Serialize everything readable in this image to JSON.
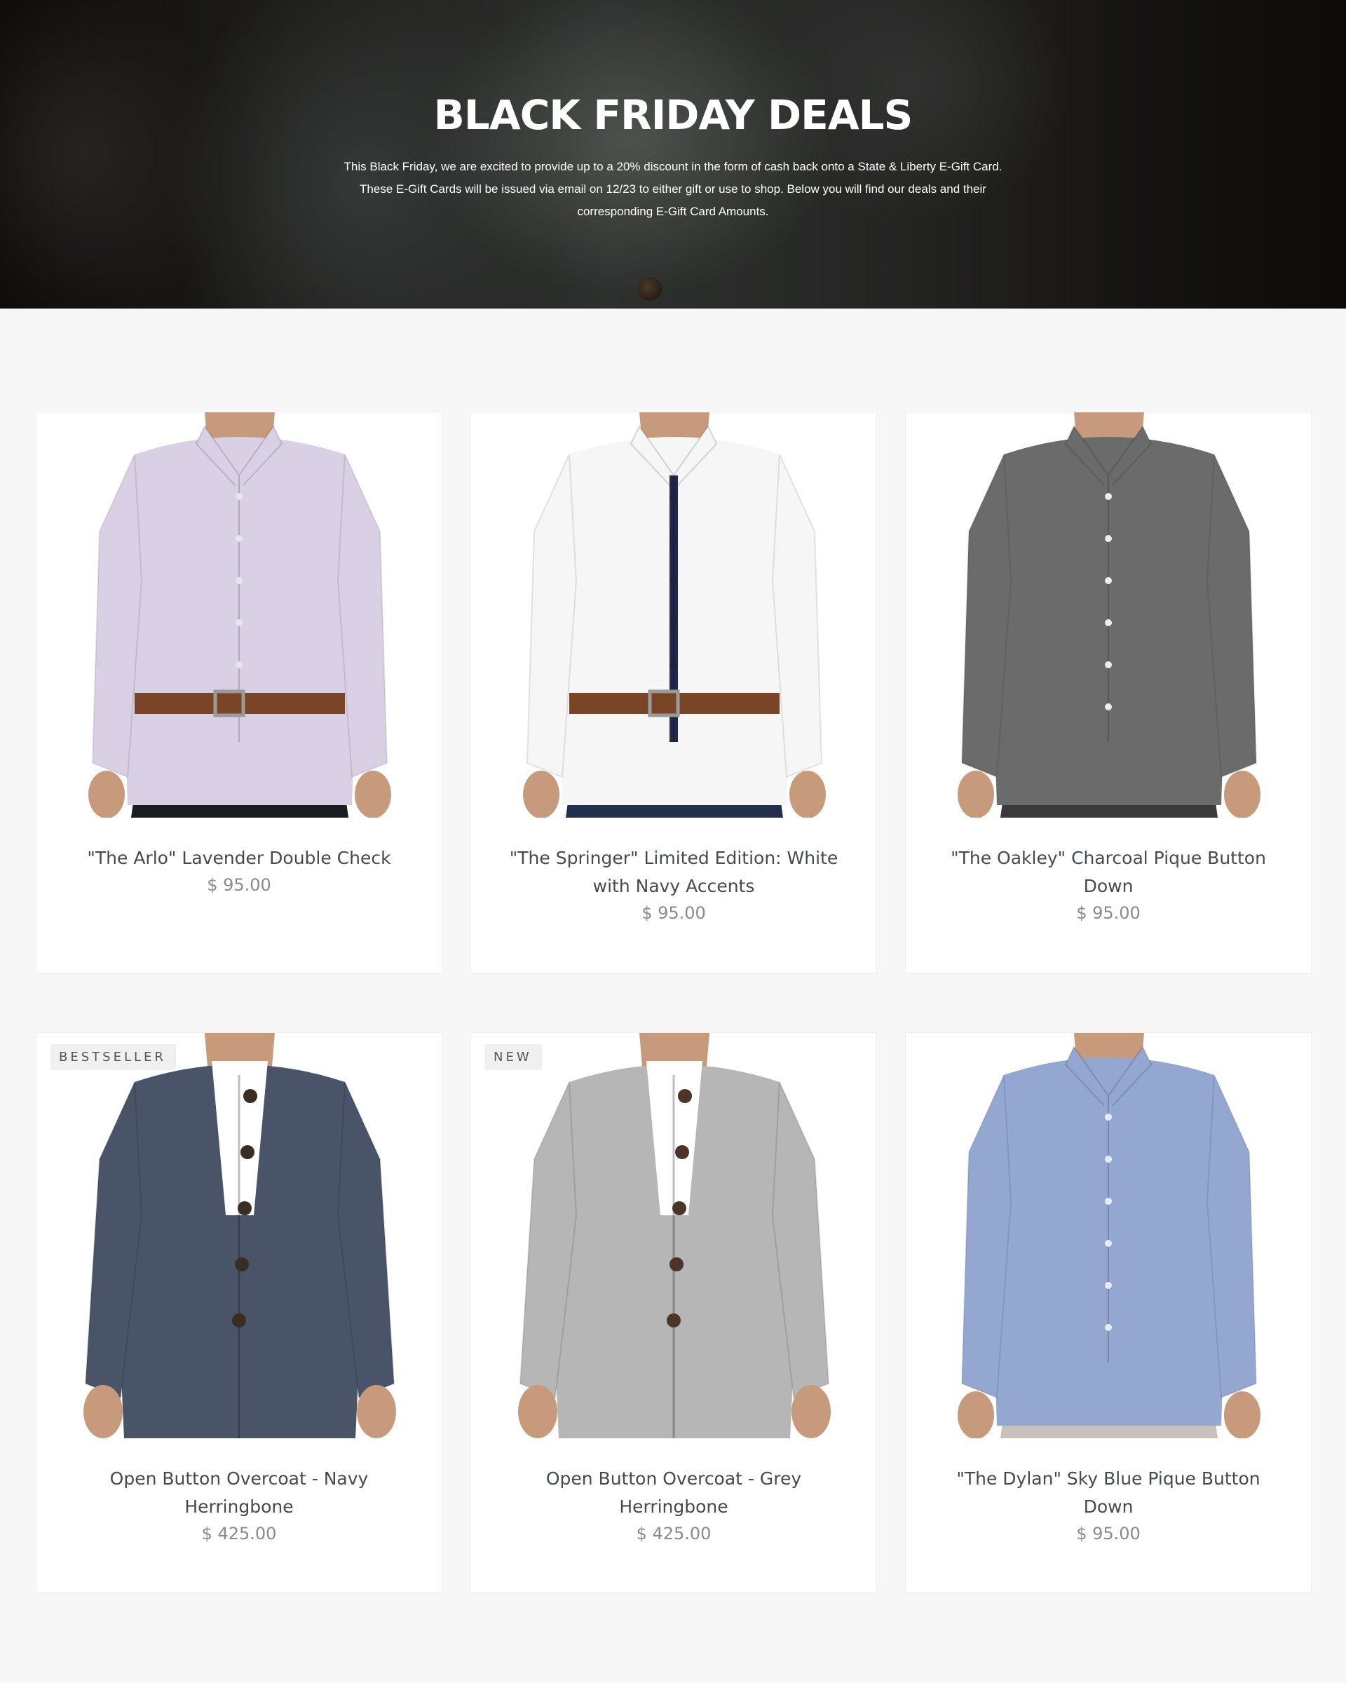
{
  "hero": {
    "title": "BLACK FRIDAY DEALS",
    "description_lines": [
      "This Black Friday, we are excited to provide up to a 20% discount in the form of cash back onto a State & Liberty E-Gift Card.",
      "These E-Gift Cards will be issued via email on 12/23 to either gift or use to shop. Below you will find our deals and their",
      "corresponding E-Gift Card Amounts."
    ]
  },
  "products": [
    {
      "title": "\"The Arlo\" Lavender Double Check",
      "price": "$ 95.00",
      "badge": "",
      "garment": "shirt",
      "shirt_color": "#d9d0e6",
      "pants_color": "#1b1c22",
      "button_color": "#e8e4ee",
      "placket_color": "#d9d0e6"
    },
    {
      "title": "\"The Springer\" Limited Edition: White with Navy Accents",
      "price": "$ 95.00",
      "badge": "",
      "garment": "shirt",
      "shirt_color": "#f6f6f7",
      "pants_color": "#22304e",
      "button_color": "#1c2540",
      "placket_color": "#1f2a4a"
    },
    {
      "title": "\"The Oakley\" Charcoal Pique Button Down",
      "price": "$ 95.00",
      "badge": "",
      "garment": "shirt",
      "shirt_color": "#6b6b6b",
      "pants_color": "#3a3a3a",
      "button_color": "#ededed",
      "placket_color": "#6b6b6b"
    },
    {
      "title": "Open Button Overcoat - Navy Herringbone",
      "price": "$ 425.00",
      "badge": "BESTSELLER",
      "garment": "coat",
      "shirt_color": "#4a5468",
      "pants_color": "#27334e",
      "button_color": "#3a2e24",
      "placket_color": "#ffffff"
    },
    {
      "title": "Open Button Overcoat - Grey Herringbone",
      "price": "$ 425.00",
      "badge": "NEW",
      "garment": "coat",
      "shirt_color": "#b6b6b6",
      "pants_color": "#1d2232",
      "button_color": "#4a3526",
      "placket_color": "#ffffff"
    },
    {
      "title": "\"The Dylan\" Sky Blue Pique Button Down",
      "price": "$ 95.00",
      "badge": "",
      "garment": "shirt",
      "shirt_color": "#93a7d0",
      "pants_color": "#c9c2bb",
      "button_color": "#e6ebf5",
      "placket_color": "#93a7d0"
    }
  ]
}
